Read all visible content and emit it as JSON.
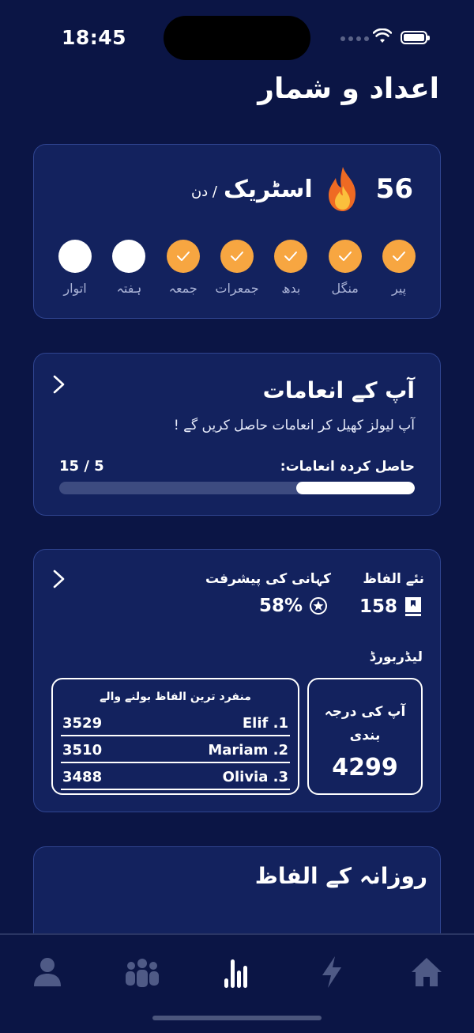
{
  "status_bar": {
    "time": "18:45"
  },
  "page": {
    "title": "اعداد و شمار"
  },
  "streak": {
    "count": "56",
    "label": "اسٹریک",
    "per_day": "/ دن",
    "days": [
      {
        "label": "پیر",
        "done": true
      },
      {
        "label": "منگل",
        "done": true
      },
      {
        "label": "بدھ",
        "done": true
      },
      {
        "label": "جمعرات",
        "done": true
      },
      {
        "label": "جمعہ",
        "done": true
      },
      {
        "label": "ہفتہ",
        "done": false
      },
      {
        "label": "اتوار",
        "done": false
      }
    ]
  },
  "rewards": {
    "title": "آپ کے انعامات",
    "subtitle": "آپ لیولز کھیل کر انعامات حاصل کریں گے !",
    "earned_label": "حاصل کردہ انعامات:",
    "count_text": "15 / 5",
    "progress_fraction": 0.333
  },
  "stats": {
    "new_words_label": "نئے الفاظ",
    "new_words_value": "158",
    "story_label": "کہانی کی پیشرفت",
    "story_value": "58%",
    "leaderboard_label": "لیڈربورڈ",
    "rank_label": "آپ کی درجہ بندی",
    "rank_value": "4299",
    "top_title": "منفرد ترین الفاظ بولنے والے",
    "top": [
      {
        "name": "Elif .1",
        "score": "3529"
      },
      {
        "name": "Mariam .2",
        "score": "3510"
      },
      {
        "name": "Olivia .3",
        "score": "3488"
      }
    ]
  },
  "daily": {
    "title": "روزانہ کے الفاظ"
  },
  "colors": {
    "background": "#0b1545",
    "card": "#13225e",
    "accent": "#f7a641",
    "active_tab": "#ffffff",
    "inactive_tab": "#4f5a86"
  },
  "tabs": [
    {
      "icon": "home-icon",
      "active": false
    },
    {
      "icon": "lightning-icon",
      "active": false
    },
    {
      "icon": "stats-icon",
      "active": true
    },
    {
      "icon": "group-icon",
      "active": false
    },
    {
      "icon": "profile-icon",
      "active": false
    }
  ]
}
